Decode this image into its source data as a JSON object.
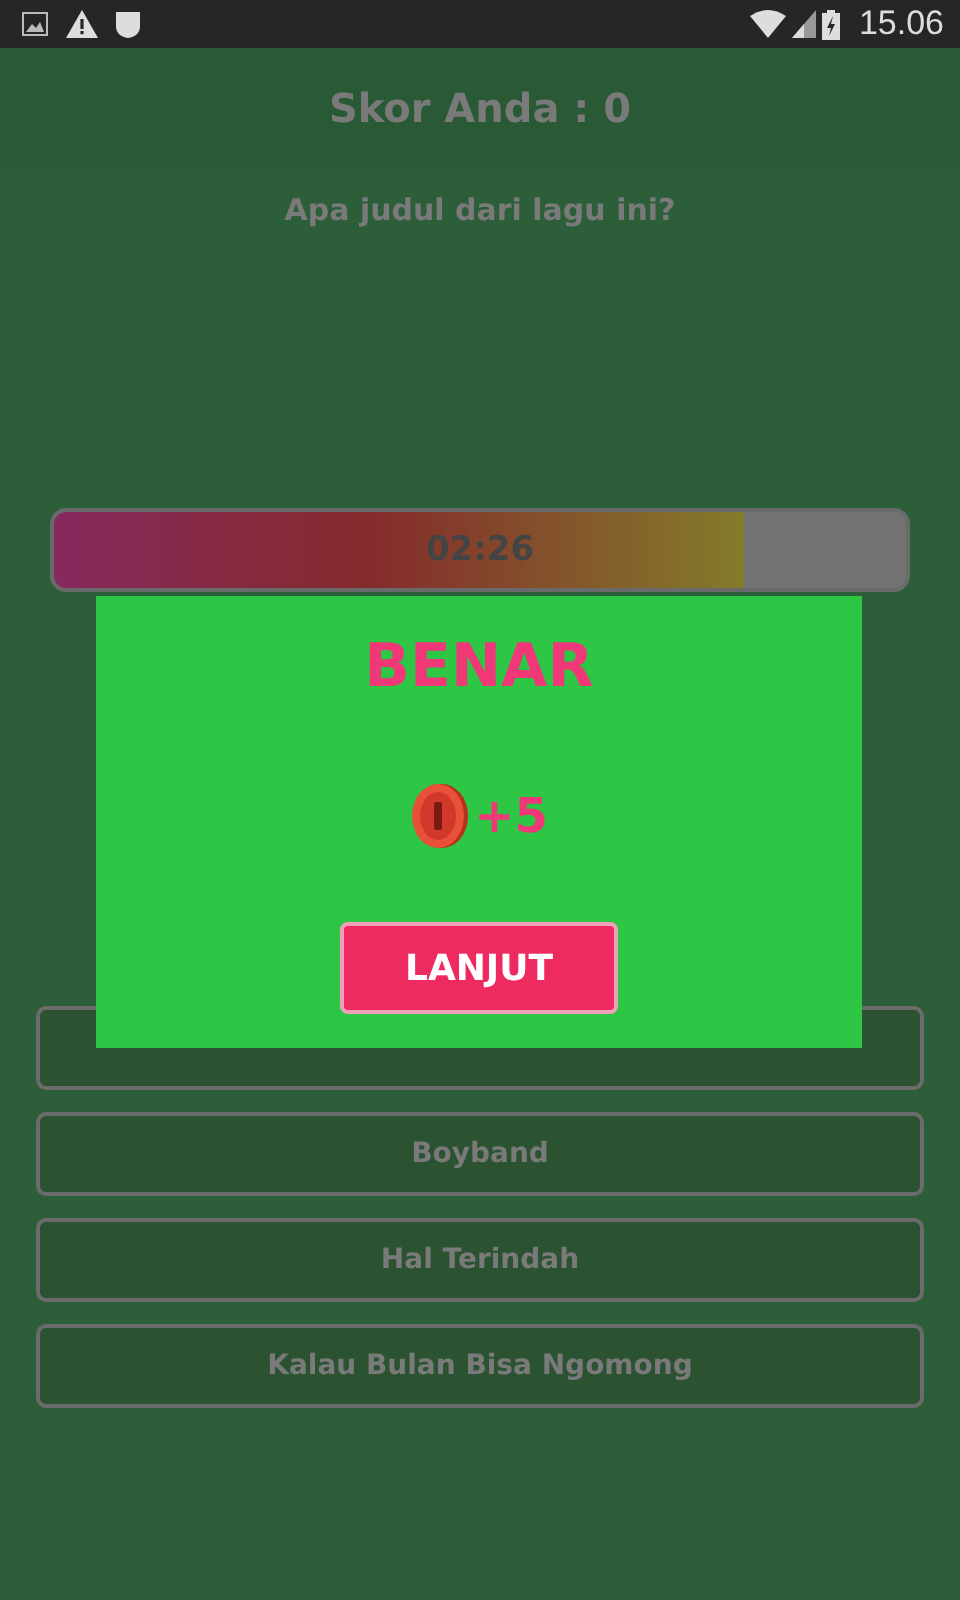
{
  "status_bar": {
    "time": "15.06"
  },
  "header": {
    "title": "Skor Anda : 0"
  },
  "question": "Apa judul dari lagu ini?",
  "timer": {
    "reading": "02:26",
    "level": 0.81
  },
  "answers": [
    {
      "kind": "covered"
    },
    {
      "kind": "text",
      "label": "Boyband"
    },
    {
      "kind": "text",
      "label": "Hal Terindah"
    },
    {
      "kind": "text",
      "label": "Kalau Bulan Bisa Ngomong"
    }
  ],
  "dialog": {
    "title": "BENAR",
    "reward": "+5",
    "button": "LANJUT"
  }
}
